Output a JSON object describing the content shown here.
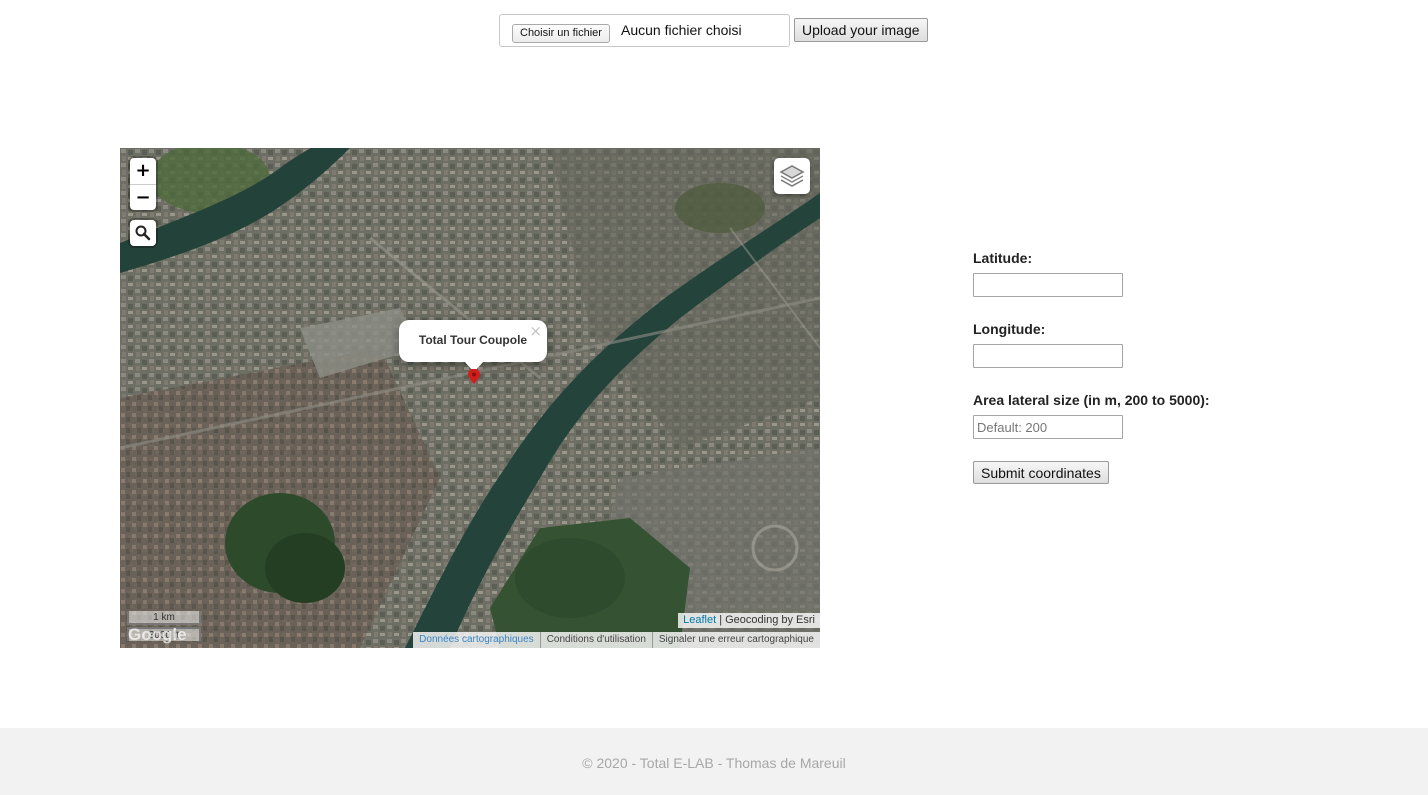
{
  "upload": {
    "choose_file_label": "Choisir un fichier",
    "file_status": "Aucun fichier choisi",
    "upload_button": "Upload your image"
  },
  "map": {
    "zoom_in": "+",
    "zoom_out": "−",
    "popup_title": "Total Tour Coupole",
    "popup_close": "×",
    "scale_metric": "1 km",
    "scale_imperial": "3000 ft",
    "google_logo": "Google",
    "attribution_leaflet": "Leaflet",
    "attribution_geocoding": "Geocoding by Esri",
    "google_links": [
      "Données cartographiques",
      "Conditions d'utilisation",
      "Signaler une erreur cartographique"
    ]
  },
  "form": {
    "latitude_label": "Latitude:",
    "latitude_value": "",
    "longitude_label": "Longitude:",
    "longitude_value": "",
    "area_label": "Area lateral size (in m, 200 to 5000):",
    "area_placeholder": "Default: 200",
    "submit_button": "Submit coordinates"
  },
  "footer": {
    "text": "© 2020 - Total E-LAB - Thomas de Mareuil"
  },
  "colors": {
    "link": "#0078a8",
    "marker": "#d21d1d",
    "footer_bg": "#f2f2f2"
  }
}
